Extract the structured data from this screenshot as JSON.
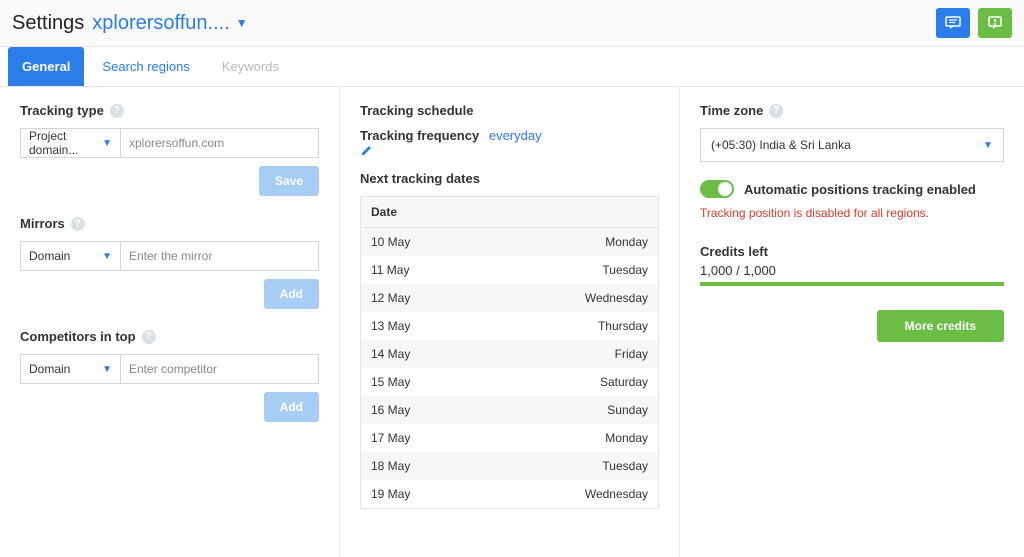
{
  "header": {
    "page_title": "Settings",
    "project_name": "xplorersoffun...."
  },
  "tabs": {
    "general": "General",
    "search_regions": "Search regions",
    "keywords": "Keywords"
  },
  "left": {
    "tracking_type_label": "Tracking type",
    "tracking_type_select": "Project domain...",
    "tracking_type_input": "xplorersoffun.com",
    "save_btn": "Save",
    "mirrors_label": "Mirrors",
    "mirrors_select": "Domain",
    "mirrors_input": "Enter the mirror",
    "add_btn": "Add",
    "competitors_label": "Competitors in top",
    "competitors_select": "Domain",
    "competitors_input": "Enter competitor"
  },
  "mid": {
    "schedule_label": "Tracking schedule",
    "freq_label": "Tracking frequency",
    "freq_value": "everyday",
    "next_dates_label": "Next tracking dates",
    "date_header": "Date",
    "dates": [
      {
        "d": "10 May",
        "w": "Monday"
      },
      {
        "d": "11 May",
        "w": "Tuesday"
      },
      {
        "d": "12 May",
        "w": "Wednesday"
      },
      {
        "d": "13 May",
        "w": "Thursday"
      },
      {
        "d": "14 May",
        "w": "Friday"
      },
      {
        "d": "15 May",
        "w": "Saturday"
      },
      {
        "d": "16 May",
        "w": "Sunday"
      },
      {
        "d": "17 May",
        "w": "Monday"
      },
      {
        "d": "18 May",
        "w": "Tuesday"
      },
      {
        "d": "19 May",
        "w": "Wednesday"
      }
    ]
  },
  "right": {
    "timezone_label": "Time zone",
    "timezone_value": "(+05:30) India & Sri Lanka",
    "auto_label": "Automatic positions tracking enabled",
    "warn": "Tracking position is disabled for all regions.",
    "credits_label": "Credits left",
    "credits_value": "1,000 / 1,000",
    "more_credits": "More credits"
  }
}
